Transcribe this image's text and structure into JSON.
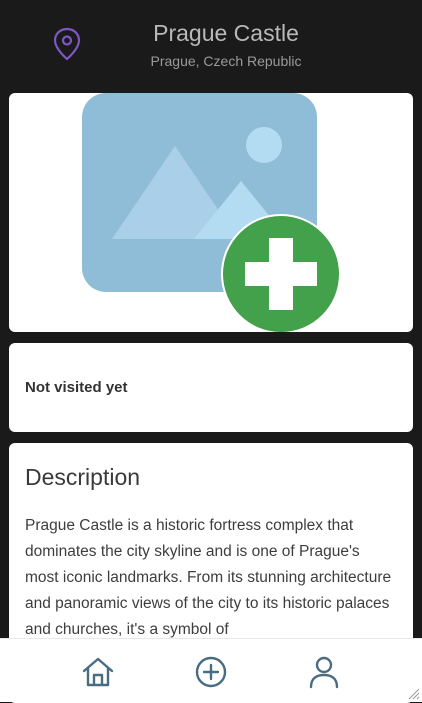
{
  "header": {
    "title": "Prague Castle",
    "subtitle": "Prague, Czech Republic",
    "icon": "location-pin-icon"
  },
  "image_card": {
    "placeholder_icon": "image-placeholder-icon",
    "add_icon": "add-photo-plus-icon",
    "colors": {
      "placeholder": "#8fbcd6",
      "add": "#43a04b"
    }
  },
  "status": {
    "text": "Not visited yet"
  },
  "description": {
    "title": "Description",
    "body": "Prague Castle is a historic fortress complex that dominates the city skyline and is one of Prague's most iconic landmarks. From its stunning architecture and panoramic views of the city to its historic palaces and churches, it's a symbol of"
  },
  "bottom_nav": {
    "items": [
      {
        "id": "home",
        "icon": "home-icon"
      },
      {
        "id": "add",
        "icon": "add-circle-icon"
      },
      {
        "id": "profile",
        "icon": "user-icon"
      }
    ],
    "color": "#4a6c82"
  },
  "colors": {
    "accent": "#7e57c2",
    "background": "#1a1a1a"
  }
}
